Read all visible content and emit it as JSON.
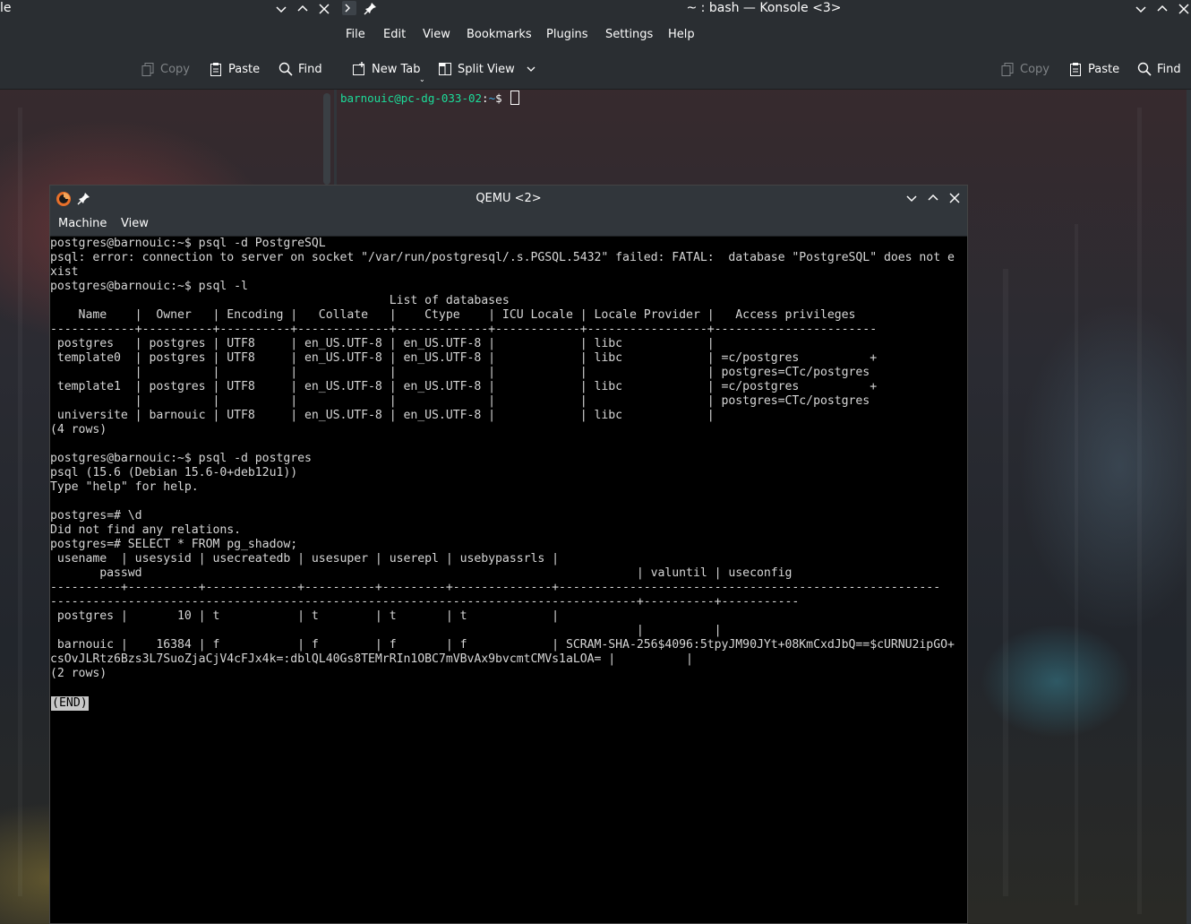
{
  "left_window": {
    "title_fragment": "le",
    "toolbar": {
      "copy": "Copy",
      "paste": "Paste",
      "find": "Find"
    }
  },
  "konsole": {
    "title": "~ : bash — Konsole <3>",
    "menu": [
      "File",
      "Edit",
      "View",
      "Bookmarks",
      "Plugins",
      "Settings",
      "Help"
    ],
    "toolbar": {
      "new_tab": "New Tab",
      "split_view": "Split View",
      "copy": "Copy",
      "paste": "Paste",
      "find": "Find"
    },
    "prompt": {
      "user_host": "barnouic@pc-dg-033-02",
      "sep": ":",
      "path": "~",
      "symbol": "$ "
    }
  },
  "qemu": {
    "title": "QEMU <2>",
    "menu": [
      "Machine",
      "View"
    ],
    "console_text": "postgres@barnouic:~$ psql -d PostgreSQL\npsql: error: connection to server on socket \"/var/run/postgresql/.s.PGSQL.5432\" failed: FATAL:  database \"PostgreSQL\" does not e\nxist\npostgres@barnouic:~$ psql -l\n                                                List of databases\n    Name    |  Owner   | Encoding |   Collate   |    Ctype    | ICU Locale | Locale Provider |   Access privileges\n------------+----------+----------+-------------+-------------+------------+-----------------+-----------------------\n postgres   | postgres | UTF8     | en_US.UTF-8 | en_US.UTF-8 |            | libc            |\n template0  | postgres | UTF8     | en_US.UTF-8 | en_US.UTF-8 |            | libc            | =c/postgres          +\n            |          |          |             |             |            |                 | postgres=CTc/postgres\n template1  | postgres | UTF8     | en_US.UTF-8 | en_US.UTF-8 |            | libc            | =c/postgres          +\n            |          |          |             |             |            |                 | postgres=CTc/postgres\n universite | barnouic | UTF8     | en_US.UTF-8 | en_US.UTF-8 |            | libc            |\n(4 rows)\n\npostgres@barnouic:~$ psql -d postgres\npsql (15.6 (Debian 15.6-0+deb12u1))\nType \"help\" for help.\n\npostgres=# \\d\nDid not find any relations.\npostgres=# SELECT * FROM pg_shadow;\n usename  | usesysid | usecreatedb | usesuper | userepl | usebypassrls |\n       passwd                                                                      | valuntil | useconfig\n----------+----------+-------------+----------+---------+--------------+------------------------------------------------------\n-----------------------------------------------------------------------------------+----------+-----------\n postgres |       10 | t           | t        | t       | t            |\n                                                                                   |          |\n barnouic |    16384 | f           | f        | f       | f            | SCRAM-SHA-256$4096:5tpyJM90JYt+08KmCxdJbQ==$cURNU2ipGO+\ncsOvJLRtz6Bzs3L7SuoZjaCjV4cFJx4k=:dblQL40Gs8TEMrRIn1OBC7mVBvAx9bvcmtCMVs1aLOA= |          |\n(2 rows)",
    "pager_end": "(END)"
  }
}
